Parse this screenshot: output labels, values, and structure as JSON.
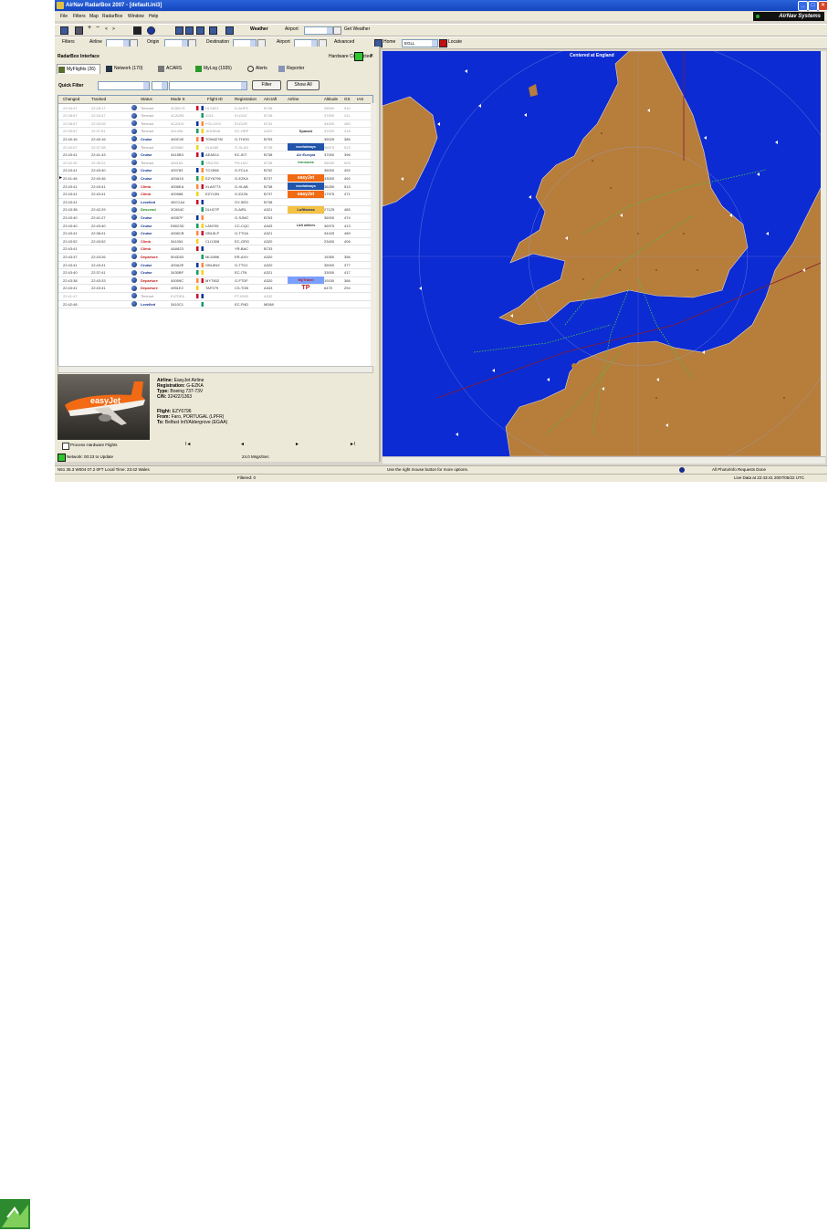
{
  "window": {
    "title": "AirNav RadarBox 2007 - [default.ini3]"
  },
  "brand": {
    "name": "AirNav Systems"
  },
  "menu": [
    "File",
    "Filters",
    "Map",
    "RadarBox",
    "Window",
    "Help"
  ],
  "toolbar1": {
    "weather_label": "Weather",
    "airport_label": "Airport",
    "get_weather": "Get Weather"
  },
  "toolbar2": {
    "filters_label": "Filters",
    "airline_label": "Airline",
    "origin_label": "Origin",
    "destination_label": "Destination",
    "airport_label": "Airport",
    "advanced_label": "Advanced",
    "home_label": "Home",
    "home_value": "EGLL",
    "locate_label": "Locate"
  },
  "panel": {
    "title": "RadarBox Interface",
    "hardware_status": "Hardware Connected",
    "tabs": [
      "MyFlights (26)",
      "Network (170)",
      "ACARS",
      "MyLog (1935)",
      "Alerts",
      "Reporter"
    ],
    "quick_filter_label": "Quick Filter",
    "filter_button": "Filter",
    "show_all_button": "Show All"
  },
  "grid": {
    "columns": [
      "Changed",
      "Tracked",
      "Status",
      "Mode S",
      "Flight ID",
      "Registration",
      "Aircraft",
      "Airline",
      "Altitude",
      "GS",
      "IAS"
    ],
    "rows": [
      {
        "changed": "22:34:47",
        "tracked": "22:25:17",
        "status": "Timeout",
        "modes": "3C6ECS",
        "flight": "HLX821",
        "reg": "D-AHFS",
        "ac": "B738",
        "airline": "",
        "alt": "36000",
        "gs": "510",
        "active": false
      },
      {
        "changed": "22:38:57",
        "tracked": "22:34:47",
        "status": "Timeout",
        "modes": "4CA295",
        "flight": "1124",
        "reg": "EI-DGZ",
        "ac": "B738",
        "airline": "",
        "alt": "37000",
        "gs": "411",
        "active": false
      },
      {
        "changed": "22:38:57",
        "tracked": "22:33:05",
        "status": "Timeout",
        "modes": "4CA319",
        "flight": "FGL1203",
        "reg": "EI-DOR",
        "ac": "B734",
        "airline": "",
        "alt": "34000",
        "gs": "480",
        "active": false
      },
      {
        "changed": "22:39:57",
        "tracked": "22:37:51",
        "status": "Timeout",
        "modes": "341496",
        "flight": "JKK9646",
        "reg": "EC-HRP",
        "ac": "A320",
        "airline": "Spanair",
        "alt": "37000",
        "gs": "418",
        "active": false
      },
      {
        "changed": "22:40:16",
        "tracked": "22:40:16",
        "status": "Cruise",
        "modes": "400C09",
        "flight": "TOM427M",
        "reg": "G-THOG",
        "ac": "B753",
        "airline": "",
        "alt": "35025",
        "gs": "385",
        "active": true
      },
      {
        "changed": "22:40:07",
        "tracked": "22:37:38",
        "status": "Timeout",
        "modes": "40096B",
        "flight": "XLA285",
        "reg": "G-XLAG",
        "ac": "B738",
        "airline": "excelairways",
        "alt": "36975",
        "gs": "513",
        "active": false
      },
      {
        "changed": "22:43:41",
        "tracked": "22:41:43",
        "status": "Cruise",
        "modes": "3415B3",
        "flight": "AEA514",
        "reg": "EC-IDT",
        "ac": "B738",
        "airline": "Air Europa",
        "alt": "37000",
        "gs": "396",
        "active": true
      },
      {
        "changed": "22:42:30",
        "tracked": "22:35:22",
        "status": "Timeout",
        "modes": "484160",
        "flight": "TRA760",
        "reg": "PH-HZC",
        "ac": "B738",
        "airline": "transavia",
        "alt": "36000",
        "gs": "505",
        "active": false
      },
      {
        "changed": "22:43:41",
        "tracked": "22:43:40",
        "status": "Cruise",
        "modes": "400783",
        "flight": "TCX566",
        "reg": "G-FCLA",
        "ac": "B752",
        "airline": "",
        "alt": "36000",
        "gs": "492",
        "active": true
      },
      {
        "changed": "22:41:46",
        "tracked": "22:40:46",
        "status": "Cruise",
        "modes": "400A15",
        "flight": "EZY6796",
        "reg": "G-EZKA",
        "ac": "B737",
        "airline": "easyJet",
        "alt": "33000",
        "gs": "492",
        "active": true
      },
      {
        "changed": "22:43:41",
        "tracked": "22:43:41",
        "status": "Climb",
        "modes": "4006EA",
        "flight": "XLA9773",
        "reg": "G-XLAB",
        "ac": "B738",
        "airline": "excelairways",
        "alt": "36250",
        "gs": "513",
        "active": true
      },
      {
        "changed": "22:43:41",
        "tracked": "22:43:41",
        "status": "Climb",
        "modes": "400968",
        "flight": "EZY13N",
        "reg": "G-EZJN",
        "ac": "B737",
        "airline": "easyJet",
        "alt": "17975",
        "gs": "471",
        "active": true
      },
      {
        "changed": "22:43:41",
        "tracked": "",
        "status": "Levelled",
        "modes": "45CCA4",
        "flight": "",
        "reg": "OY-SED",
        "ac": "B738",
        "airline": "",
        "alt": "",
        "gs": "",
        "active": true
      },
      {
        "changed": "22:43:38",
        "tracked": "22:42:29",
        "status": "Descend",
        "modes": "3C664C",
        "flight": "DLH27P",
        "reg": "D-AIRL",
        "ac": "A321",
        "airline": "Lufthansa",
        "alt": "27125",
        "gs": "465",
        "active": true
      },
      {
        "changed": "22:43:40",
        "tracked": "22:41:27",
        "status": "Cruise",
        "modes": "40057F",
        "flight": "",
        "reg": "G-SJMC",
        "ac": "B763",
        "airline": "",
        "alt": "36000",
        "gs": "474",
        "active": true
      },
      {
        "changed": "22:43:40",
        "tracked": "22:43:40",
        "status": "Cruise",
        "modes": "E8023D",
        "flight": "LAN705",
        "reg": "CC-CQC",
        "ac": "A343",
        "airline": "LAN airlines",
        "alt": "36975",
        "gs": "413",
        "active": true
      },
      {
        "changed": "22:43:41",
        "tracked": "22:38:41",
        "status": "Cruise",
        "modes": "4006CB",
        "flight": "GBL5LP",
        "reg": "G-TTOA",
        "ac": "A321",
        "airline": "",
        "alt": "34425",
        "gs": "489",
        "active": true
      },
      {
        "changed": "22:43:52",
        "tracked": "22:43:52",
        "status": "Climb",
        "modes": "341054",
        "flight": "CLI1308",
        "reg": "EC-GRG",
        "ac": "A320",
        "airline": "",
        "alt": "23400",
        "gs": "406",
        "active": true
      },
      {
        "changed": "22:43:41",
        "tracked": "",
        "status": "Climb",
        "modes": "4A0823",
        "flight": "",
        "reg": "YR-BAC",
        "ac": "B733",
        "airline": "",
        "alt": "",
        "gs": "",
        "active": true
      },
      {
        "changed": "22:43:37",
        "tracked": "22:43:26",
        "status": "Departure",
        "modes": "504D53",
        "flight": "MLD896",
        "reg": "ER-AXV",
        "ac": "A320",
        "airline": "",
        "alt": "15350",
        "gs": "356",
        "active": true
      },
      {
        "changed": "22:43:41",
        "tracked": "22:43:41",
        "status": "Cruise",
        "modes": "400A2E",
        "flight": "GBL8NX",
        "reg": "G-TTOJ",
        "ac": "A320",
        "airline": "",
        "alt": "35000",
        "gs": "377",
        "active": true
      },
      {
        "changed": "22:43:40",
        "tracked": "22:37:41",
        "status": "Cruise",
        "modes": "3430BF",
        "flight": "",
        "reg": "EC-ITN",
        "ac": "A321",
        "airline": "",
        "alt": "33000",
        "gs": "417",
        "active": true
      },
      {
        "changed": "22:43:38",
        "tracked": "22:43:33",
        "status": "Departure",
        "modes": "40059C",
        "flight": "MYT602",
        "reg": "G-FTDF",
        "ac": "A320",
        "airline": "MyTravel",
        "alt": "19150",
        "gs": "366",
        "active": true
      },
      {
        "changed": "22:43:41",
        "tracked": "22:43:41",
        "status": "Departure",
        "modes": "4951E2",
        "flight": "TAP279",
        "reg": "CS-TOB",
        "ac": "A343",
        "airline": "TP",
        "alt": "6475",
        "gs": "294",
        "active": true
      },
      {
        "changed": "22:41:47",
        "tracked": "",
        "status": "Timeout",
        "modes": "E47DE6",
        "flight": "",
        "reg": "PT-MVB",
        "ac": "A332",
        "airline": "",
        "alt": "",
        "gs": "",
        "active": false
      },
      {
        "changed": "22:42:48",
        "tracked": "",
        "status": "Levelled",
        "modes": "3410C1",
        "flight": "",
        "reg": "EC-FND",
        "ac": "MD88",
        "airline": "",
        "alt": "",
        "gs": "",
        "active": true
      }
    ]
  },
  "details": {
    "airline_label": "Airline:",
    "airline": "EasyJet Airline",
    "registration_label": "Registration:",
    "registration": "G-EZKA",
    "type_label": "Type:",
    "type": "Boeing 737-73V",
    "cn_label": "C/N:",
    "cn": "32422/1363",
    "flight_label": "Flight:",
    "flight": "EZY6796",
    "from_label": "From:",
    "from": "Faro, PORTUGAL (LPFR)",
    "to_label": "To:",
    "to": "Belfast Int'l/Aldergrove (EGAA)"
  },
  "controls": {
    "process_label": "Process Hardware Flights",
    "first": "I◄",
    "prev": "◄",
    "next": "►",
    "last": "►I"
  },
  "status": {
    "network": "Network: 00:23 to Update",
    "speed": "24.0 Msgs/Sec",
    "coords": "N51 35.3 W004 07.2   0FT   Local Time: 23:42 Wales",
    "filtered": "Filtered: 0",
    "hint": "Use the right mouse button for more options.",
    "photo_requests": "All Photo/Info Requests Done",
    "live": "Live Data at 22:43:41 2007/05/22 UTC"
  },
  "map": {
    "centered_label": "Centered at England"
  },
  "colors": {
    "sea": "#0d2bd2",
    "land": "#b67d3b",
    "title_bar": "#1a52d0"
  }
}
